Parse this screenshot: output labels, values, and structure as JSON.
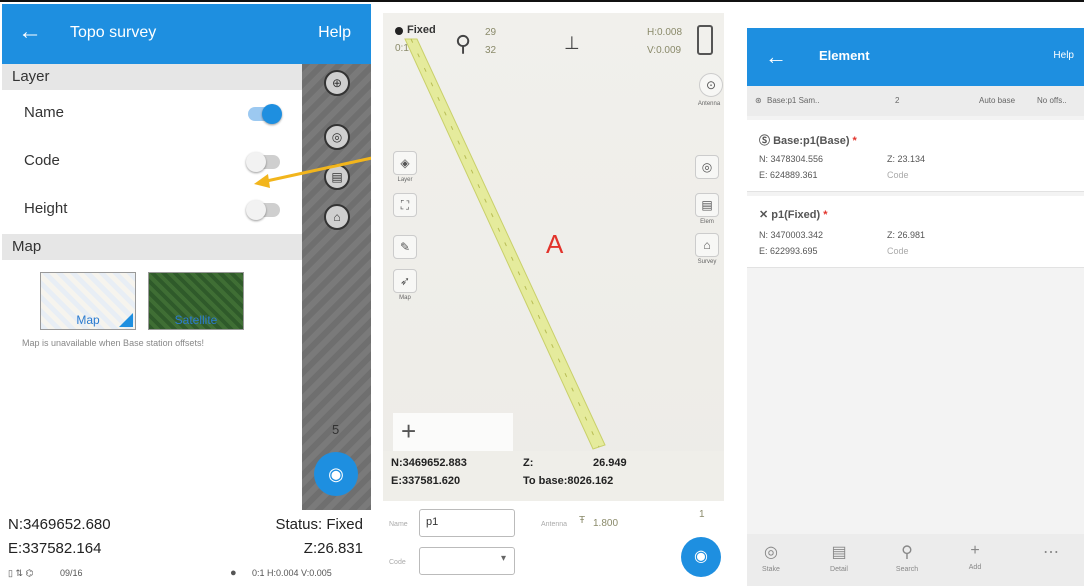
{
  "colors": {
    "accent": "#1e8fe0",
    "warning_arrow": "#f2b51c",
    "fixed_red": "#e2332b"
  },
  "panel1": {
    "header": {
      "back_icon": "←",
      "title": "Topo survey",
      "help": "Help"
    },
    "layer_section": "Layer",
    "layer_rows": [
      {
        "label": "Name",
        "enabled": true
      },
      {
        "label": "Code",
        "enabled": false
      },
      {
        "label": "Height",
        "enabled": false
      }
    ],
    "map_section": "Map",
    "map_types": [
      {
        "label": "Map",
        "selected": true
      },
      {
        "label": "Satellite",
        "selected": false
      }
    ],
    "map_note": "Map is unavailable when Base station offsets!",
    "side_number": "5",
    "footer": {
      "north": "N:3469652.680",
      "east": "E:337582.164",
      "status": "Status: Fixed",
      "z": "Z:26.831",
      "sats": "09/16",
      "precision": "0:1 H:0.004 V:0.005"
    }
  },
  "panel2": {
    "status": "Fixed",
    "age": "0:1",
    "sats_used": "29",
    "sats_visible": "32",
    "hrms": "H:0.008",
    "vrms": "V:0.009",
    "point_label": "A",
    "side_left": [
      "Layer",
      "Full",
      "Tool",
      "Map"
    ],
    "side_right": [
      "Layers",
      "Elem",
      "Survey"
    ],
    "coords": {
      "north": "N:3469652.883",
      "east": "E:337581.620",
      "z_label": "Z:",
      "z_value": "26.949",
      "to_base": "To base:8026.162"
    },
    "name_label": "Name",
    "name_value": "p1",
    "antenna_label": "Antenna",
    "antenna_value": "1.800",
    "code_label": "Code",
    "count": "1"
  },
  "panel3": {
    "header": {
      "back_icon": "←",
      "title": "Element",
      "help": "Help"
    },
    "filter": {
      "scope": "Base:p1 Sam..",
      "count": "2",
      "sort": "Auto base",
      "offset": "No offs.."
    },
    "elements": [
      {
        "name": "Base:p1(Base)",
        "n": "N: 3478304.556",
        "e": "E: 624889.361",
        "z": "Z: 23.134",
        "code": "Code"
      },
      {
        "name": "p1(Fixed)",
        "n": "N: 3470003.342",
        "e": "E: 622993.695",
        "z": "Z: 26.981",
        "code": "Code"
      }
    ],
    "nav": [
      {
        "label": "Stake",
        "icon": "◎"
      },
      {
        "label": "Detail",
        "icon": "▤"
      },
      {
        "label": "Search",
        "icon": "⚲"
      },
      {
        "label": "Add",
        "icon": "+"
      },
      {
        "label": "...",
        "icon": "⋯"
      }
    ]
  }
}
